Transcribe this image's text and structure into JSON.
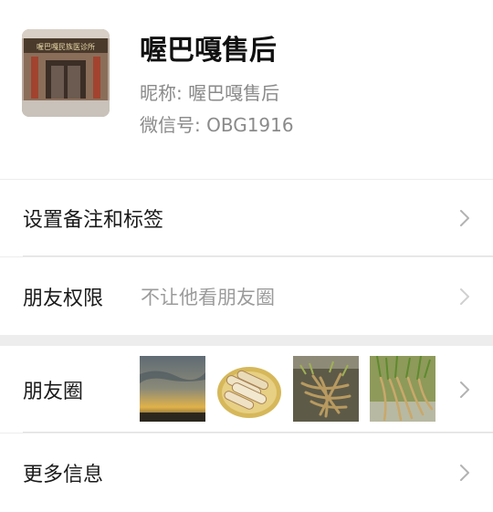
{
  "profile": {
    "name": "喔巴嘎售后",
    "nickname": "昵称: 喔巴嘎售后",
    "wechat_id": "微信号: OBG1916",
    "avatar_sign_text": "喔巴嘎民族医诊所"
  },
  "rows": {
    "remark": {
      "label": "设置备注和标签"
    },
    "permission": {
      "label": "朋友权限",
      "value": "不让他看朋友圈"
    },
    "moments": {
      "label": "朋友圈",
      "thumbnails": [
        "sunset-sky-photo",
        "sliced-root-plate-photo",
        "root-herb-photo",
        "root-herb-bundle-photo"
      ]
    },
    "more": {
      "label": "更多信息"
    }
  },
  "colors": {
    "background": "#ededed",
    "card": "#ffffff",
    "primary_text": "#1a1a1a",
    "secondary_text": "#8a8a8a",
    "chevron": "#b2b2b2"
  }
}
